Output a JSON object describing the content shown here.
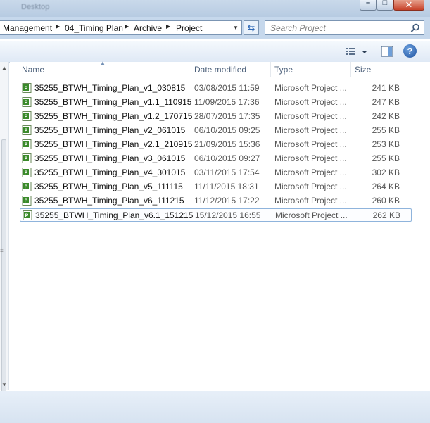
{
  "window": {
    "title": "Desktop"
  },
  "address": {
    "crumbs": [
      "Management",
      "04_Timing Plan",
      "Archive",
      "Project"
    ]
  },
  "search": {
    "placeholder": "Search Project"
  },
  "columns": {
    "name": "Name",
    "date": "Date modified",
    "type": "Type",
    "size": "Size"
  },
  "files": [
    {
      "name": "35255_BTWH_Timing_Plan_v1_030815",
      "date": "03/08/2015 11:59",
      "type": "Microsoft Project ...",
      "size": "241 KB"
    },
    {
      "name": "35255_BTWH_Timing_Plan_v1.1_110915",
      "date": "11/09/2015 17:36",
      "type": "Microsoft Project ...",
      "size": "247 KB"
    },
    {
      "name": "35255_BTWH_Timing_Plan_v1.2_170715",
      "date": "28/07/2015 17:35",
      "type": "Microsoft Project ...",
      "size": "242 KB"
    },
    {
      "name": "35255_BTWH_Timing_Plan_v2_061015",
      "date": "06/10/2015 09:25",
      "type": "Microsoft Project ...",
      "size": "255 KB"
    },
    {
      "name": "35255_BTWH_Timing_Plan_v2.1_210915",
      "date": "21/09/2015 15:36",
      "type": "Microsoft Project ...",
      "size": "253 KB"
    },
    {
      "name": "35255_BTWH_Timing_Plan_v3_061015",
      "date": "06/10/2015 09:27",
      "type": "Microsoft Project ...",
      "size": "255 KB"
    },
    {
      "name": "35255_BTWH_Timing_Plan_v4_301015",
      "date": "03/11/2015 17:54",
      "type": "Microsoft Project ...",
      "size": "302 KB"
    },
    {
      "name": "35255_BTWH_Timing_Plan_v5_111115",
      "date": "11/11/2015 18:31",
      "type": "Microsoft Project ...",
      "size": "264 KB"
    },
    {
      "name": "35255_BTWH_Timing_Plan_v6_111215",
      "date": "11/12/2015 17:22",
      "type": "Microsoft Project ...",
      "size": "260 KB"
    },
    {
      "name": "35255_BTWH_Timing_Plan_v6.1_151215",
      "date": "15/12/2015 16:55",
      "type": "Microsoft Project ...",
      "size": "262 KB",
      "selected": true
    }
  ],
  "toolbar": {
    "help_glyph": "?"
  },
  "colors": {
    "accent": "#2f6ab8",
    "selection_border": "#8fb4dc",
    "project_icon": "#3a8a2a"
  },
  "icons": {
    "file": "ms-project-file-icon",
    "search": "search-icon",
    "help": "help-icon"
  }
}
